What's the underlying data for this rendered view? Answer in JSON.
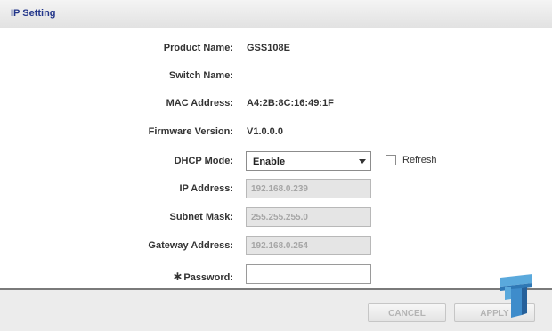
{
  "panel": {
    "title": "IP Setting"
  },
  "fields": {
    "product_name": {
      "label": "Product Name:",
      "value": "GSS108E"
    },
    "switch_name": {
      "label": "Switch Name:",
      "value": ""
    },
    "mac_address": {
      "label": "MAC Address:",
      "value": "A4:2B:8C:16:49:1F"
    },
    "firmware_version": {
      "label": "Firmware Version:",
      "value": "V1.0.0.0"
    },
    "dhcp_mode": {
      "label": "DHCP Mode:",
      "selected": "Enable"
    },
    "refresh": {
      "label": "Refresh",
      "checked": false
    },
    "ip_address": {
      "label": "IP Address:",
      "value": "192.168.0.239"
    },
    "subnet_mask": {
      "label": "Subnet Mask:",
      "value": "255.255.255.0"
    },
    "gateway_address": {
      "label": "Gateway Address:",
      "value": "192.168.0.254"
    },
    "password": {
      "required_mark": "∗",
      "label": "Password:",
      "value": ""
    }
  },
  "buttons": {
    "cancel": "CANCEL",
    "apply": "APPLY"
  },
  "colors": {
    "title": "#23368a",
    "disabled_field_bg": "#e5e5e5",
    "disabled_text": "#a6a6a6",
    "logo_blue": "#4a9fd8"
  },
  "icons": {
    "logo": "tweaktown-tt-logo",
    "dropdown": "chevron-down-icon"
  }
}
